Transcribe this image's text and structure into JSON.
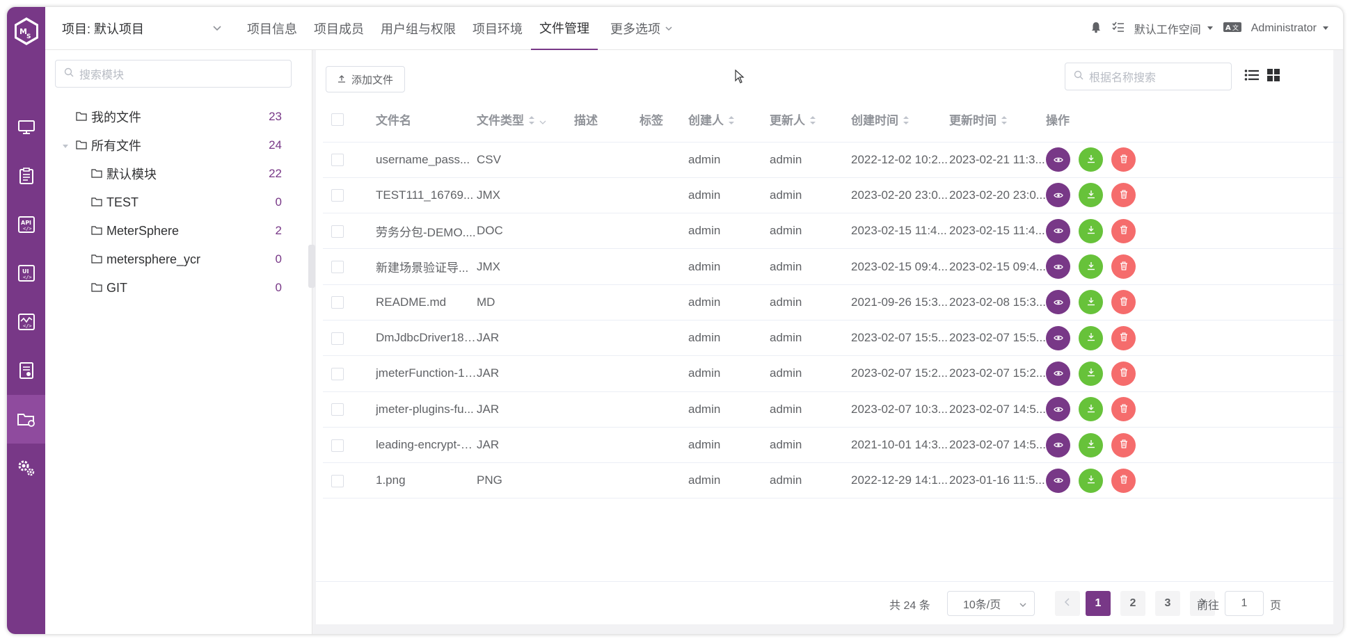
{
  "header": {
    "project_select": "项目: 默认项目",
    "nav": [
      {
        "label": "项目信息"
      },
      {
        "label": "项目成员"
      },
      {
        "label": "用户组与权限"
      },
      {
        "label": "项目环境"
      },
      {
        "label": "文件管理"
      },
      {
        "label": "更多选项"
      }
    ],
    "active_nav": "文件管理",
    "workspace": "默认工作空间",
    "user": "Administrator"
  },
  "colors": {
    "accent": "#783887",
    "success": "#67c23a",
    "danger": "#f56c6c"
  },
  "rail_icons": [
    "monitor-icon",
    "clipboard-icon",
    "api-icon",
    "ui-icon",
    "performance-icon",
    "report-icon",
    "folder-settings-icon",
    "gears-icon"
  ],
  "sidebar": {
    "search_placeholder": "搜索模块",
    "my_files": {
      "label": "我的文件",
      "count": "23"
    },
    "all_files": {
      "label": "所有文件",
      "count": "24"
    },
    "modules": [
      {
        "label": "默认模块",
        "count": "22"
      },
      {
        "label": "TEST",
        "count": "0"
      },
      {
        "label": "MeterSphere",
        "count": "2"
      },
      {
        "label": "metersphere_ycr",
        "count": "0"
      },
      {
        "label": "GIT",
        "count": "0"
      }
    ]
  },
  "toolbar": {
    "add_file_label": "添加文件",
    "search_placeholder": "根据名称搜索"
  },
  "table": {
    "columns": {
      "name": "文件名",
      "type": "文件类型",
      "desc": "描述",
      "tags": "标签",
      "creator": "创建人",
      "updater": "更新人",
      "created": "创建时间",
      "updated": "更新时间",
      "ops": "操作"
    },
    "rows": [
      {
        "name": "username_pass...",
        "type": "CSV",
        "creator": "admin",
        "updater": "admin",
        "created": "2022-12-02 10:2...",
        "updated": "2023-02-21 11:3..."
      },
      {
        "name": "TEST111_16769...",
        "type": "JMX",
        "creator": "admin",
        "updater": "admin",
        "created": "2023-02-20 23:0...",
        "updated": "2023-02-20 23:0..."
      },
      {
        "name": "劳务分包-DEMO....",
        "type": "DOC",
        "creator": "admin",
        "updater": "admin",
        "created": "2023-02-15 11:4...",
        "updated": "2023-02-15 11:4..."
      },
      {
        "name": "新建场景验证导...",
        "type": "JMX",
        "creator": "admin",
        "updater": "admin",
        "created": "2023-02-15 09:4...",
        "updated": "2023-02-15 09:4..."
      },
      {
        "name": "README.md",
        "type": "MD",
        "creator": "admin",
        "updater": "admin",
        "created": "2021-09-26 15:3...",
        "updated": "2023-02-08 15:3..."
      },
      {
        "name": "DmJdbcDriver18....",
        "type": "JAR",
        "creator": "admin",
        "updater": "admin",
        "created": "2023-02-07 15:5...",
        "updated": "2023-02-07 15:5..."
      },
      {
        "name": "jmeterFunction-1....",
        "type": "JAR",
        "creator": "admin",
        "updater": "admin",
        "created": "2023-02-07 15:2...",
        "updated": "2023-02-07 15:2..."
      },
      {
        "name": "jmeter-plugins-fu...",
        "type": "JAR",
        "creator": "admin",
        "updater": "admin",
        "created": "2023-02-07 10:3...",
        "updated": "2023-02-07 14:5..."
      },
      {
        "name": "leading-encrypt-3...",
        "type": "JAR",
        "creator": "admin",
        "updater": "admin",
        "created": "2021-10-01 14:3...",
        "updated": "2023-02-07 14:5..."
      },
      {
        "name": "1.png",
        "type": "PNG",
        "creator": "admin",
        "updater": "admin",
        "created": "2022-12-29 14:1...",
        "updated": "2023-01-16 11:5..."
      }
    ]
  },
  "pagination": {
    "total": "共 24 条",
    "page_size": "10条/页",
    "pages": [
      "1",
      "2",
      "3"
    ],
    "current": "1",
    "goto_label": "前往",
    "goto_value": "1",
    "goto_suffix": "页"
  }
}
